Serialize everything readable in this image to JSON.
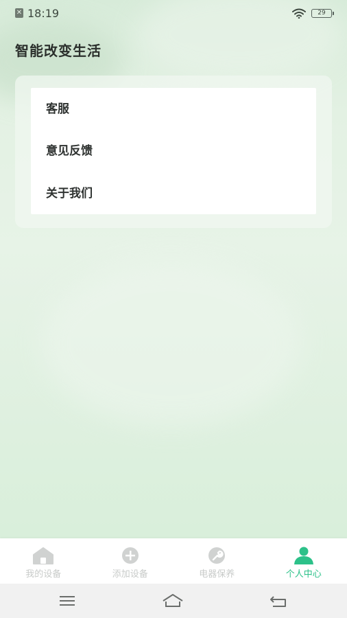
{
  "status_bar": {
    "time": "18:19",
    "battery": "29"
  },
  "header": {
    "title": "智能改变生活"
  },
  "menu": {
    "items": [
      {
        "label": "客服"
      },
      {
        "label": "意见反馈"
      },
      {
        "label": "关于我们"
      }
    ]
  },
  "tab_bar": {
    "active_color": "#2cc189",
    "inactive_color": "#c8cbc9",
    "tabs": [
      {
        "label": "我的设备",
        "icon": "home-icon",
        "active": false
      },
      {
        "label": "添加设备",
        "icon": "add-circle-icon",
        "active": false
      },
      {
        "label": "电器保养",
        "icon": "wrench-icon",
        "active": false
      },
      {
        "label": "个人中心",
        "icon": "person-icon",
        "active": true
      }
    ]
  },
  "system_nav": {
    "buttons": [
      "menu-icon",
      "home-icon",
      "back-icon"
    ]
  }
}
